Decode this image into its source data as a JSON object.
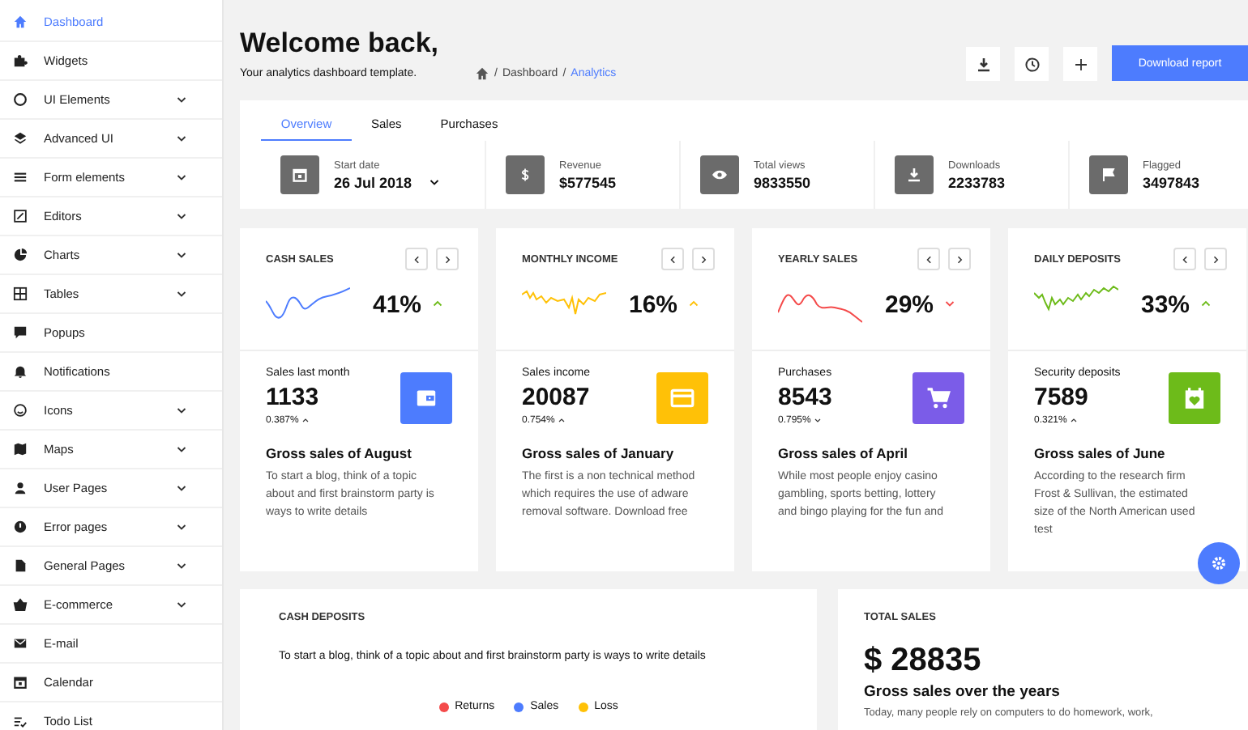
{
  "sidebar": {
    "items": [
      {
        "label": "Dashboard",
        "submenu": false,
        "selected": true
      },
      {
        "label": "Widgets",
        "submenu": false,
        "selected": false
      },
      {
        "label": "UI Elements",
        "submenu": true,
        "selected": false
      },
      {
        "label": "Advanced UI",
        "submenu": true,
        "selected": false
      },
      {
        "label": "Form elements",
        "submenu": true,
        "selected": false
      },
      {
        "label": "Editors",
        "submenu": true,
        "selected": false
      },
      {
        "label": "Charts",
        "submenu": true,
        "selected": false
      },
      {
        "label": "Tables",
        "submenu": true,
        "selected": false
      },
      {
        "label": "Popups",
        "submenu": false,
        "selected": false
      },
      {
        "label": "Notifications",
        "submenu": false,
        "selected": false
      },
      {
        "label": "Icons",
        "submenu": true,
        "selected": false
      },
      {
        "label": "Maps",
        "submenu": true,
        "selected": false
      },
      {
        "label": "User Pages",
        "submenu": true,
        "selected": false
      },
      {
        "label": "Error pages",
        "submenu": true,
        "selected": false
      },
      {
        "label": "General Pages",
        "submenu": true,
        "selected": false
      },
      {
        "label": "E-commerce",
        "submenu": true,
        "selected": false
      },
      {
        "label": "E-mail",
        "submenu": false,
        "selected": false
      },
      {
        "label": "Calendar",
        "submenu": false,
        "selected": false
      },
      {
        "label": "Todo List",
        "submenu": false,
        "selected": false
      }
    ]
  },
  "header": {
    "title": "Welcome back,",
    "subtitle": "Your analytics dashboard template.",
    "breadcrumb": {
      "separator": "/",
      "items": [
        {
          "label": "Dashboard",
          "current": false
        },
        {
          "label": "Analytics",
          "current": true
        }
      ]
    },
    "primary_button": "Download report"
  },
  "overview": {
    "tabs": [
      {
        "label": "Overview",
        "selected": true
      },
      {
        "label": "Sales",
        "selected": false
      },
      {
        "label": "Purchases",
        "selected": false
      }
    ],
    "stats": [
      {
        "label": "Start date",
        "value": "26 Jul 2018",
        "dropdown": true
      },
      {
        "label": "Revenue",
        "value": "$577545",
        "dropdown": false
      },
      {
        "label": "Total views",
        "value": "9833550",
        "dropdown": false
      },
      {
        "label": "Downloads",
        "value": "2233783",
        "dropdown": false
      },
      {
        "label": "Flagged",
        "value": "3497843",
        "dropdown": false
      }
    ]
  },
  "cards": [
    {
      "title": "CASH SALES",
      "color": "#4d7cfe",
      "percent": "41%",
      "trend_up": true,
      "label": "Sales last month",
      "value": "1133",
      "change": "0.387%",
      "change_up": true,
      "heading": "Gross sales of August",
      "text": "To start a blog, think of a topic about and first brainstorm party is ways to write details"
    },
    {
      "title": "MONTHLY INCOME",
      "color": "#ffc107",
      "percent": "16%",
      "trend_up": true,
      "label": "Sales income",
      "value": "20087",
      "change": "0.754%",
      "change_up": true,
      "heading": "Gross sales of January",
      "text": "The first is a non technical method which requires the use of adware removal software. Download free"
    },
    {
      "title": "YEARLY SALES",
      "color": "#f44a4a",
      "percent": "29%",
      "trend_up": false,
      "label": "Purchases",
      "value": "8543",
      "change": "0.795%",
      "change_up": false,
      "heading": "Gross sales of April",
      "text": "While most people enjoy casino gambling, sports betting, lottery and bingo playing for the fun and"
    },
    {
      "title": "DAILY DEPOSITS",
      "color": "#6dbb1a",
      "percent": "33%",
      "trend_up": true,
      "label": "Security deposits",
      "value": "7589",
      "change": "0.321%",
      "change_up": true,
      "heading": "Gross sales of June",
      "text": "According to the research firm Frost & Sullivan, the estimated size of the North American used test"
    }
  ],
  "cash_deposits": {
    "title": "CASH DEPOSITS",
    "text": "To start a blog, think of a topic about and first brainstorm party is ways to write details",
    "legend": [
      {
        "label": "Returns",
        "color": "#f44a4a"
      },
      {
        "label": "Sales",
        "color": "#4d7cfe"
      },
      {
        "label": "Loss",
        "color": "#ffc107"
      }
    ]
  },
  "total_sales": {
    "title": "TOTAL SALES",
    "value": "$ 28835",
    "heading": "Gross sales over the years",
    "text": "Today, many people rely on computers to do homework, work,"
  }
}
